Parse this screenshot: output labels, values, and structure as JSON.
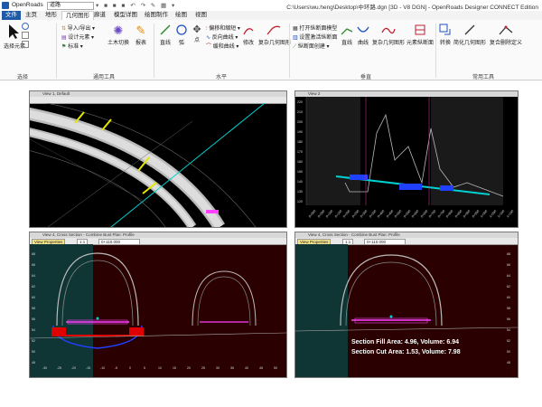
{
  "app": {
    "name": "OpenRoads",
    "workspace": "道路",
    "window_title": "C:\\Users\\wu.heng\\Desktop\\中环路.dgn [3D - V8 DGN] - OpenRoads Designer CONNECT Edition"
  },
  "tabs": [
    "文件",
    "主页",
    "地形",
    "几何图形",
    "廊道",
    "模型详图",
    "绘图制作",
    "绘图",
    "视图"
  ],
  "ribbon": {
    "select": {
      "label": "选择元素",
      "group": "选择"
    },
    "general": {
      "items": [
        "导入/导出",
        "设计元素",
        "标准"
      ],
      "big": [
        "土木切换",
        "报表"
      ],
      "group": "通用工具"
    },
    "horizontal": {
      "big": [
        "直线",
        "弧",
        "点"
      ],
      "small": [
        "偏移和缩短",
        "反向曲线",
        "缓和曲线"
      ],
      "big2": [
        "修改",
        "复杂几何图形"
      ],
      "group": "水平"
    },
    "vertical": {
      "small": [
        "打开纵断面模型",
        "设置激活纵断面",
        "纵断面创建"
      ],
      "big": [
        "直线",
        "曲线",
        "复杂几何图形",
        "元素纵断面"
      ],
      "group": "垂直"
    },
    "common": {
      "big": [
        "转换",
        "简化几何图形",
        "复合删除定义"
      ],
      "group": "常用工具"
    }
  },
  "views": {
    "plan": {
      "title": "View 1, Default"
    },
    "profile": {
      "title": "View 2"
    },
    "xs1": {
      "title": "View 4, Cross Section - Combine Bust Plan: Profile",
      "dropdown": "View Properties",
      "scale": "1:1",
      "station": "0+110.000"
    },
    "xs2": {
      "title": "View 4, Cross Section - Combine Bust Plan: Profile",
      "dropdown": "View Properties",
      "scale": "1:1",
      "station": "0+110.000"
    }
  },
  "results": {
    "fill": "Section Fill Area: 4.96, Volume: 6.94",
    "cut": "Section Cut Area: 1.53, Volume: 7.98"
  },
  "axes": {
    "profile_y": [
      "220",
      "210",
      "200",
      "190",
      "180",
      "170",
      "160",
      "150",
      "140",
      "130",
      "120"
    ],
    "profile_x": [
      "0+000",
      "0+050",
      "0+100",
      "0+150",
      "0+200",
      "0+250",
      "0+300",
      "0+350",
      "0+400",
      "0+450",
      "0+500",
      "0+550",
      "0+600",
      "0+650",
      "0+700",
      "0+750",
      "0+800",
      "0+850",
      "0+900",
      "0+950",
      "1+000",
      "1+050",
      "1+100",
      "1+150"
    ],
    "xs_y": [
      "68",
      "66",
      "64",
      "62",
      "60",
      "58",
      "56",
      "54",
      "52",
      "50",
      "48"
    ],
    "xs_x": [
      "-30",
      "-25",
      "-20",
      "-15",
      "-10",
      "-5",
      "0",
      "5",
      "10",
      "15",
      "20",
      "25",
      "30",
      "35",
      "40",
      "45",
      "50"
    ]
  },
  "colors": {
    "accent": "#1e5aa8",
    "fill": "#ff0000",
    "cut": "#2040ff",
    "design": "#ff40ff",
    "alignment": "#00d0d0"
  }
}
